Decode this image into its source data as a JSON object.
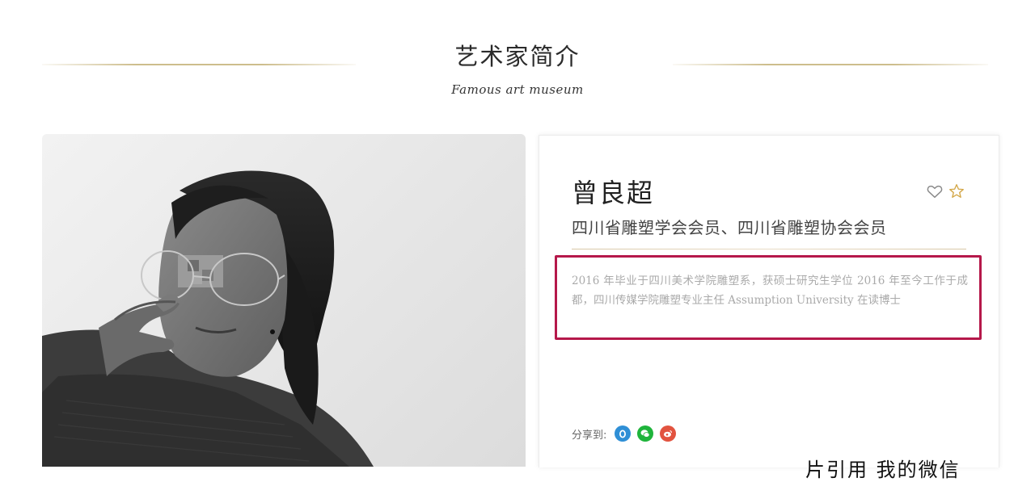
{
  "section": {
    "title": "艺术家简介",
    "subtitle": "Famous art museum"
  },
  "artist": {
    "name": "曾良超",
    "roles": "四川省雕塑学会会员、四川省雕塑协会会员",
    "bio": "2016 年毕业于四川美术学院雕塑系，获硕士研究生学位 2016 年至今工作于成都，四川传媒学院雕塑专业主任 Assumption University 在读博士"
  },
  "actions": {
    "favorite_icon": "heart-outline-icon",
    "star_icon": "star-outline-icon"
  },
  "share": {
    "label": "分享到:",
    "icons": [
      "qq-icon",
      "wechat-icon",
      "weibo-icon"
    ]
  },
  "overlay": {
    "partial_caption": "片引用 我的微信"
  },
  "colors": {
    "gold_line": "#cdbd8c",
    "highlight_border": "#b5184a",
    "qq": "#2f8fd6",
    "wechat": "#1fb43b",
    "weibo": "#e2533f"
  }
}
